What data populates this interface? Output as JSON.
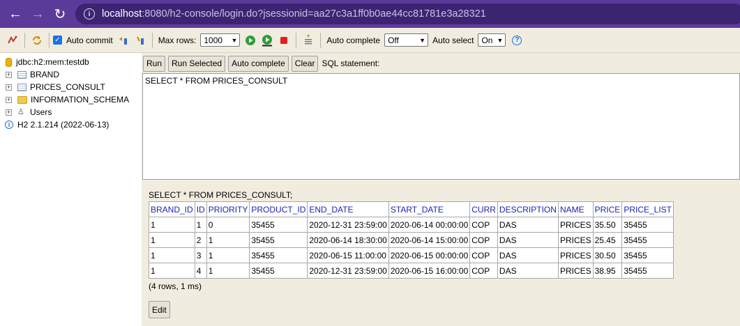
{
  "browser": {
    "url_host": "localhost",
    "url_rest": ":8080/h2-console/login.do?jsessionid=aa27c3a1ff0b0ae44cc81781e3a28321"
  },
  "toolbar": {
    "auto_commit_label": "Auto commit",
    "max_rows_label": "Max rows:",
    "max_rows_value": "1000",
    "auto_complete_label": "Auto complete",
    "auto_complete_value": "Off",
    "auto_select_label": "Auto select",
    "auto_select_value": "On"
  },
  "tree": {
    "db_label": "jdbc:h2:mem:testdb",
    "items": [
      {
        "label": "BRAND"
      },
      {
        "label": "PRICES_CONSULT"
      },
      {
        "label": "INFORMATION_SCHEMA"
      },
      {
        "label": "Users"
      }
    ],
    "version": "H2 2.1.214 (2022-06-13)"
  },
  "buttons": {
    "run": "Run",
    "run_selected": "Run Selected",
    "auto_complete": "Auto complete",
    "clear": "Clear",
    "sql_label": "SQL statement:",
    "edit": "Edit"
  },
  "sql_text": "SELECT * FROM PRICES_CONSULT",
  "result": {
    "title": "SELECT * FROM PRICES_CONSULT;",
    "columns": [
      "BRAND_ID",
      "ID",
      "PRIORITY",
      "PRODUCT_ID",
      "END_DATE",
      "START_DATE",
      "CURR",
      "DESCRIPTION",
      "NAME",
      "PRICE",
      "PRICE_LIST"
    ],
    "rows": [
      [
        "1",
        "1",
        "0",
        "35455",
        "2020-12-31 23:59:00",
        "2020-06-14 00:00:00",
        "COP",
        "DAS",
        "PRICES",
        "35.50",
        "35455"
      ],
      [
        "1",
        "2",
        "1",
        "35455",
        "2020-06-14 18:30:00",
        "2020-06-14 15:00:00",
        "COP",
        "DAS",
        "PRICES",
        "25.45",
        "35455"
      ],
      [
        "1",
        "3",
        "1",
        "35455",
        "2020-06-15 11:00:00",
        "2020-06-15 00:00:00",
        "COP",
        "DAS",
        "PRICES",
        "30.50",
        "35455"
      ],
      [
        "1",
        "4",
        "1",
        "35455",
        "2020-12-31 23:59:00",
        "2020-06-15 16:00:00",
        "COP",
        "DAS",
        "PRICES",
        "38.95",
        "35455"
      ]
    ],
    "row_count": "(4 rows, 1 ms)"
  }
}
